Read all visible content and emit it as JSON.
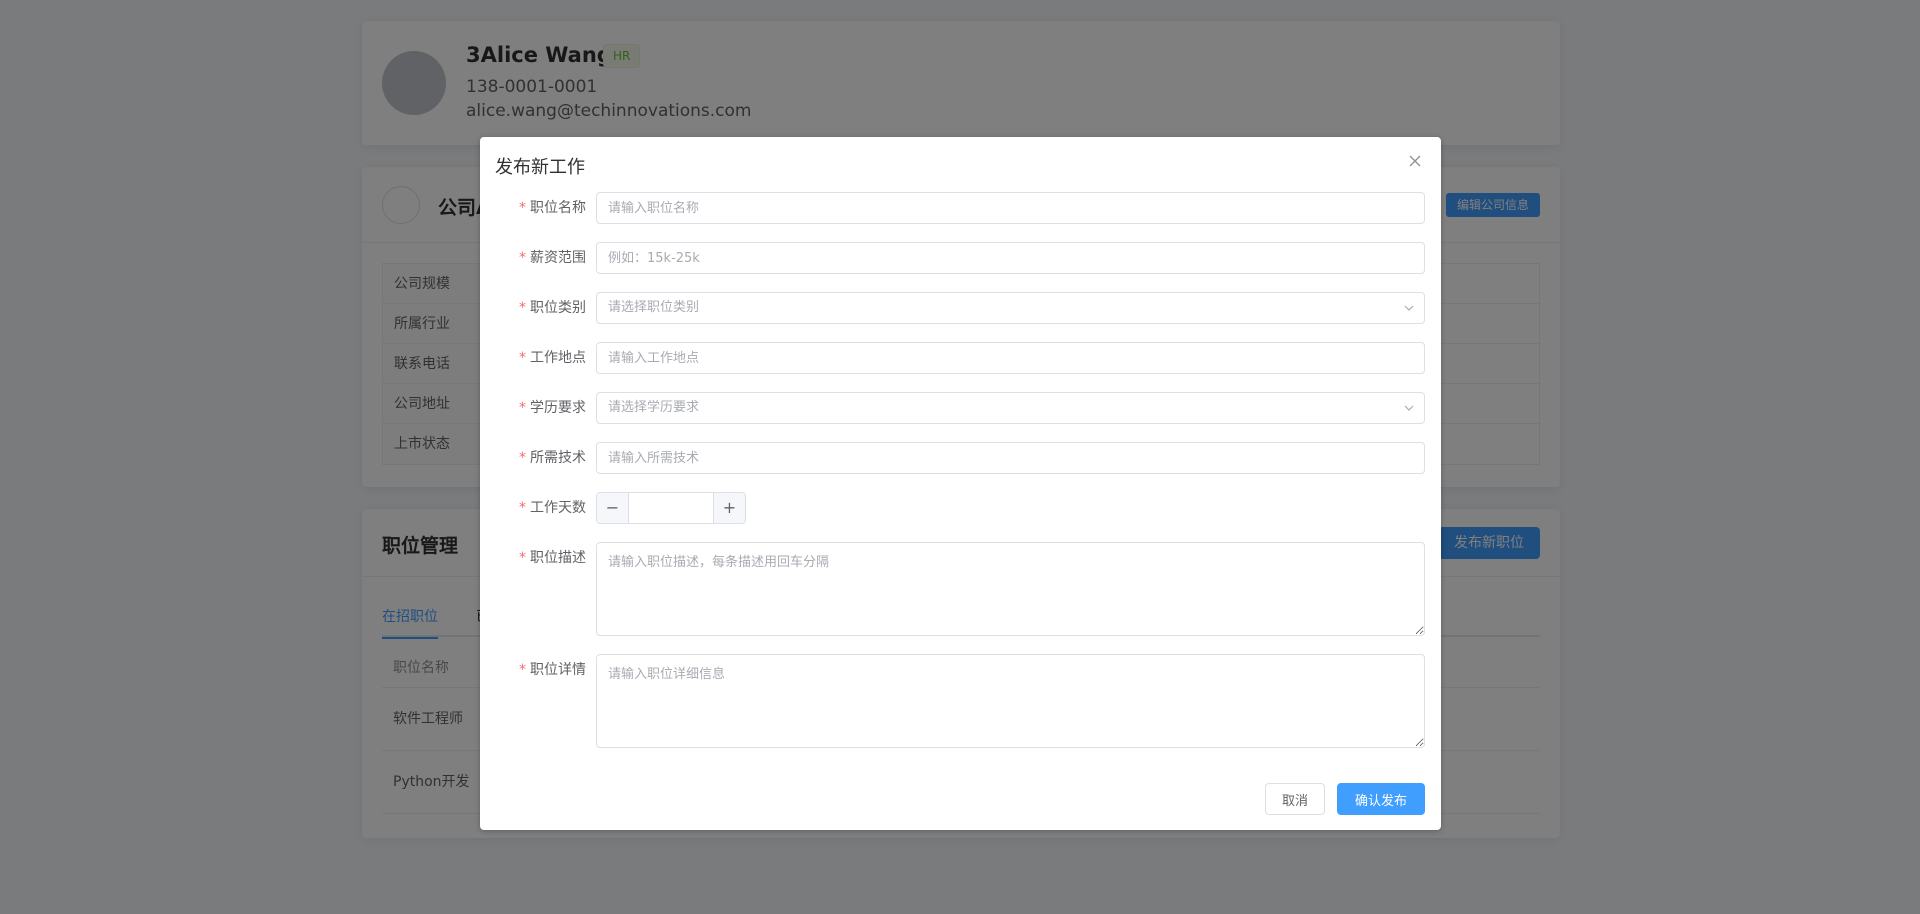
{
  "profile": {
    "name": "3Alice Wang",
    "role_tag": "HR",
    "phone": "138-0001-0001",
    "email": "alice.wang@techinnovations.com"
  },
  "company": {
    "name_partial": "公司A",
    "edit_button": "编辑公司信息",
    "info_labels": [
      "公司规模",
      "所属行业",
      "联系电话",
      "公司地址",
      "上市状态"
    ]
  },
  "jobs": {
    "title": "职位管理",
    "publish_button": "发布新职位",
    "tabs": [
      "在招职位",
      "已"
    ],
    "table_header": "职位名称",
    "rows": [
      "软件工程师",
      "Python开发"
    ]
  },
  "dialog": {
    "title": "发布新工作",
    "fields": {
      "job_name": {
        "label": "职位名称",
        "placeholder": "请输入职位名称"
      },
      "salary": {
        "label": "薪资范围",
        "placeholder": "例如：15k-25k"
      },
      "category": {
        "label": "职位类别",
        "placeholder": "请选择职位类别"
      },
      "location": {
        "label": "工作地点",
        "placeholder": "请输入工作地点"
      },
      "education": {
        "label": "学历要求",
        "placeholder": "请选择学历要求"
      },
      "skills": {
        "label": "所需技术",
        "placeholder": "请输入所需技术"
      },
      "work_days": {
        "label": "工作天数",
        "value": "",
        "minus": "−",
        "plus": "+"
      },
      "description": {
        "label": "职位描述",
        "placeholder": "请输入职位描述，每条描述用回车分隔"
      },
      "detail": {
        "label": "职位详情",
        "placeholder": "请输入职位详细信息"
      }
    },
    "required_mark": "*",
    "cancel_button": "取消",
    "confirm_button": "确认发布"
  },
  "colors": {
    "primary": "#409eff",
    "required": "#f56c6c",
    "tag_green": "#67c23a"
  }
}
